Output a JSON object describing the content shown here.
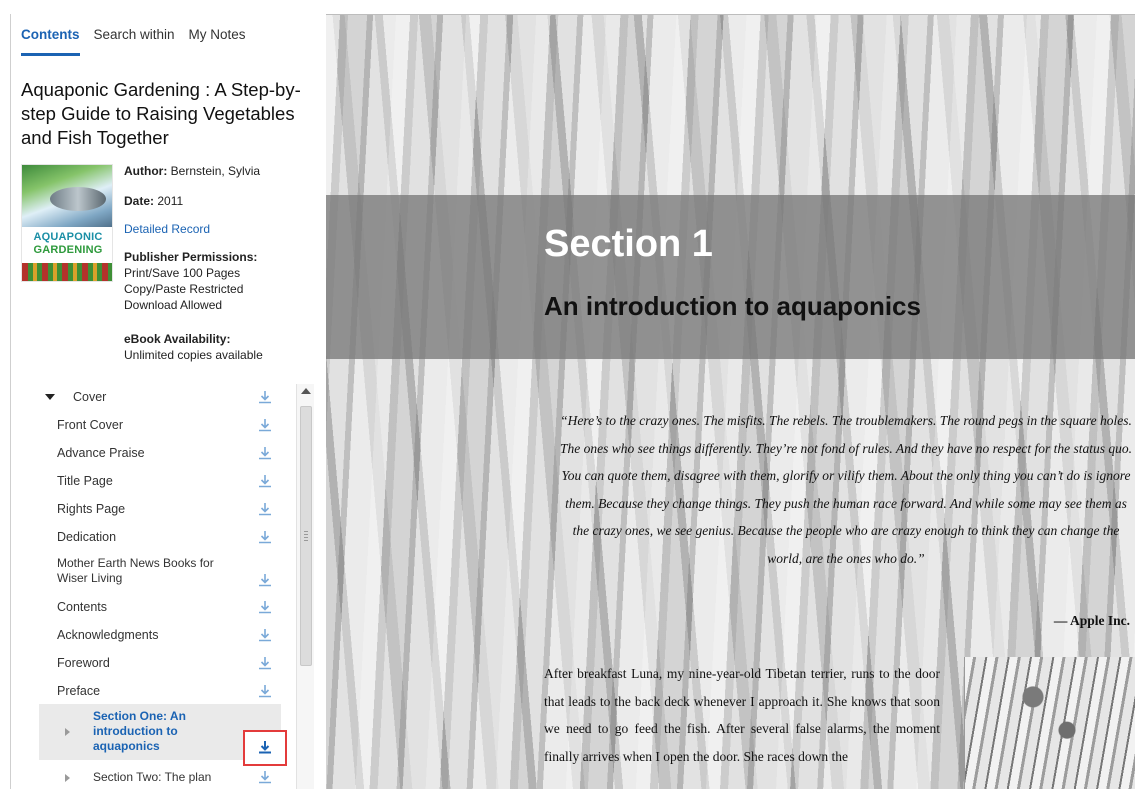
{
  "sidebar": {
    "tabs": [
      "Contents",
      "Search within",
      "My Notes"
    ],
    "book": {
      "title": "Aquaponic Gardening : A Step-by-step Guide to Raising Vegetables and Fish Together",
      "cover_line1": "AQUAPONIC",
      "cover_line2": "GARDENING",
      "author_label": "Author:",
      "author": "Bernstein, Sylvia",
      "date_label": "Date:",
      "date": "2011",
      "detailed_record": "Detailed Record",
      "permissions_label": "Publisher Permissions:",
      "permissions": [
        "Print/Save 100 Pages",
        "Copy/Paste Restricted",
        "Download Allowed"
      ],
      "availability_label": "eBook Availability:",
      "availability": "Unlimited copies available"
    },
    "toc": [
      {
        "label": "Cover"
      },
      {
        "label": "Front Cover"
      },
      {
        "label": "Advance Praise"
      },
      {
        "label": "Title Page"
      },
      {
        "label": "Rights Page"
      },
      {
        "label": "Dedication"
      },
      {
        "label": "Mother Earth News Books for Wiser Living"
      },
      {
        "label": "Contents"
      },
      {
        "label": "Acknowledgments"
      },
      {
        "label": "Foreword"
      },
      {
        "label": "Preface"
      },
      {
        "label": "Section One: An introduction to aquaponics"
      },
      {
        "label": "Section Two: The plan"
      }
    ]
  },
  "reader": {
    "section_number": "Section 1",
    "section_title": "An introduction to aquaponics",
    "quote": "“Here’s to the crazy ones. The misfits. The rebels. The troublemakers. The round pegs in the square holes. The ones who see things differently. They’re not fond of rules. And they have no respect for the status quo. You can quote them, disagree with them, glorify or vilify them. About the only thing you can’t do is ignore them. Because they change things. They push the human race forward. And while some may see them as the crazy ones, we see genius. Because the people who are crazy enough to think they can change the world, are the ones who do.”",
    "attribution": "— Apple Inc.",
    "body": "After breakfast Luna, my nine-year-old Tibetan terrier, runs to the door that leads to the back deck whenever I approach it. She knows that soon we need to go feed the fish. After several false alarms, the moment finally arrives when I open the door. She races down the"
  },
  "colors": {
    "link_blue": "#1b63b3",
    "highlight_red": "#e33b3b",
    "selected_bg": "#eaeaea",
    "band_gray": "#787878"
  }
}
